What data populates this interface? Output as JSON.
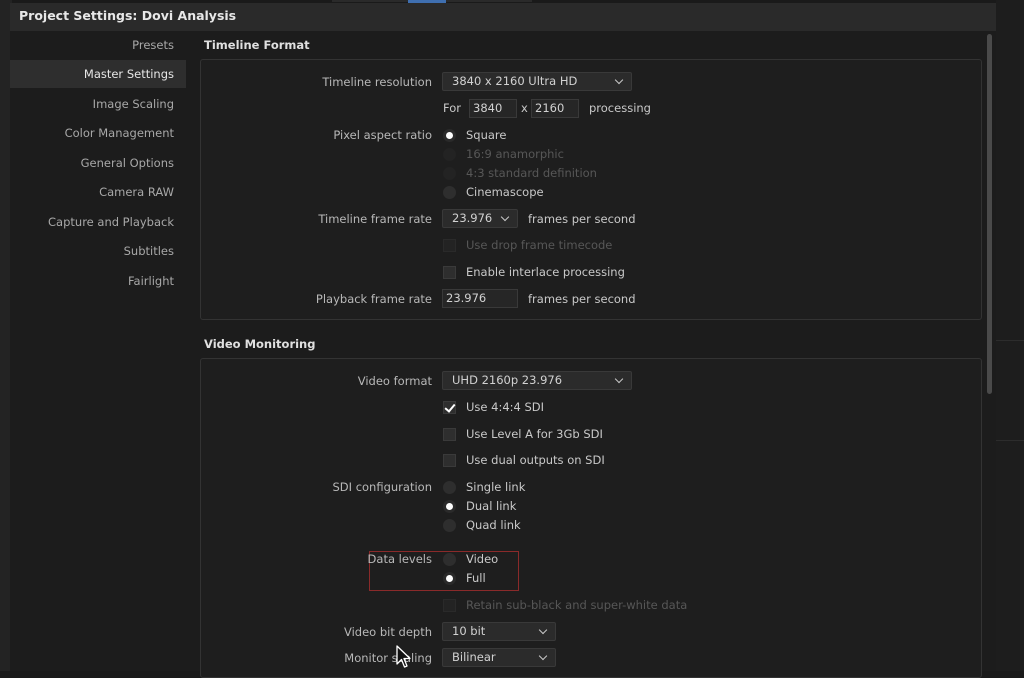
{
  "title": "Project Settings:  Dovi Analysis",
  "sidebar": {
    "items": [
      {
        "label": "Presets"
      },
      {
        "label": "Master Settings"
      },
      {
        "label": "Image Scaling"
      },
      {
        "label": "Color Management"
      },
      {
        "label": "General Options"
      },
      {
        "label": "Camera RAW"
      },
      {
        "label": "Capture and Playback"
      },
      {
        "label": "Subtitles"
      },
      {
        "label": "Fairlight"
      }
    ],
    "active": "Master Settings"
  },
  "timeline_format": {
    "section_title": "Timeline Format",
    "resolution_label": "Timeline resolution",
    "resolution_value": "3840 x 2160 Ultra HD",
    "for_label": "For",
    "width": "3840",
    "x_label": "x",
    "height": "2160",
    "processing_label": "processing",
    "pixel_aspect_label": "Pixel aspect ratio",
    "pixel_aspect_options": [
      "Square",
      "16:9 anamorphic",
      "4:3 standard definition",
      "Cinemascope"
    ],
    "pixel_aspect_selected": "Square",
    "frame_rate_label": "Timeline frame rate",
    "frame_rate_value": "23.976",
    "fps_label": "frames per second",
    "drop_frame_label": "Use drop frame timecode",
    "interlace_label": "Enable interlace processing",
    "playback_rate_label": "Playback frame rate",
    "playback_rate_value": "23.976",
    "playback_fps_label": "frames per second"
  },
  "video_monitoring": {
    "section_title": "Video Monitoring",
    "format_label": "Video format",
    "format_value": "UHD 2160p 23.976",
    "use444_label": "Use 4:4:4 SDI",
    "use444_checked": true,
    "levelA_label": "Use Level A for 3Gb SDI",
    "dual_outputs_label": "Use dual outputs on SDI",
    "sdi_config_label": "SDI configuration",
    "sdi_options": [
      "Single link",
      "Dual link",
      "Quad link"
    ],
    "sdi_selected": "Dual link",
    "data_levels_label": "Data levels",
    "data_levels_options": [
      "Video",
      "Full"
    ],
    "data_levels_selected": "Full",
    "retain_label": "Retain sub-black and super-white data",
    "bit_depth_label": "Video bit depth",
    "bit_depth_value": "10 bit",
    "monitor_scaling_label": "Monitor scaling",
    "monitor_scaling_value": "Bilinear"
  },
  "colors": {
    "accent": "#3f6fb0",
    "highlight_border": "#8a2a2a"
  }
}
